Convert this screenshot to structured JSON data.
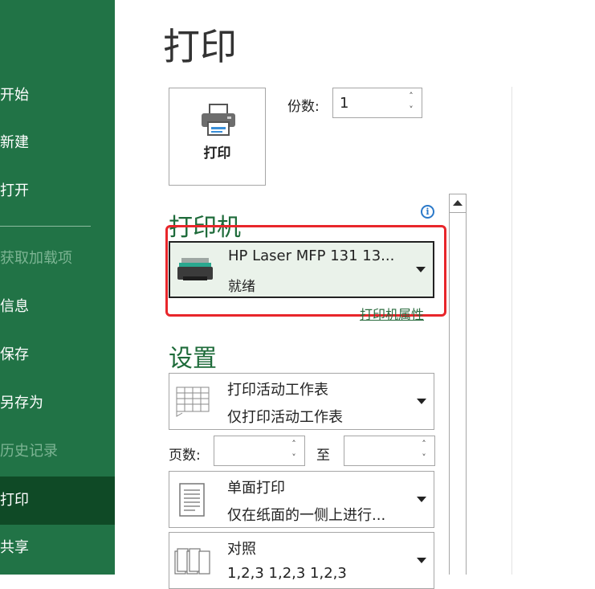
{
  "sidebar": {
    "items": [
      {
        "label": "开始",
        "state": "normal"
      },
      {
        "label": "新建",
        "state": "normal"
      },
      {
        "label": "打开",
        "state": "normal"
      },
      {
        "label": "获取加载项",
        "state": "disabled"
      },
      {
        "label": "信息",
        "state": "normal"
      },
      {
        "label": "保存",
        "state": "normal"
      },
      {
        "label": "另存为",
        "state": "normal"
      },
      {
        "label": "历史记录",
        "state": "disabled"
      },
      {
        "label": "打印",
        "state": "active"
      },
      {
        "label": "共享",
        "state": "normal"
      }
    ]
  },
  "page_title": "打印",
  "print_button": {
    "label": "打印",
    "icon": "printer-icon"
  },
  "copies": {
    "label": "份数:",
    "value": "1"
  },
  "printer_section": {
    "title": "打印机",
    "info_icon": "i",
    "printer_name": "HP Laser MFP 131 13...",
    "printer_status": "就绪",
    "properties_link": "打印机属性"
  },
  "settings_section": {
    "title": "设置",
    "print_what": {
      "line1": "打印活动工作表",
      "line2": "仅打印活动工作表"
    },
    "pages": {
      "label": "页数:",
      "to_label": "至",
      "from_value": "",
      "to_value": ""
    },
    "sides": {
      "line1": "单面打印",
      "line2": "仅在纸面的一侧上进行..."
    },
    "collate": {
      "line1": "对照",
      "line2": "1,2,3    1,2,3    1,2,3"
    }
  },
  "colors": {
    "sidebar": "#217346",
    "sidebar_active": "#0f4a26",
    "highlight": "#e8262b",
    "section_title": "#1e6b3a"
  }
}
